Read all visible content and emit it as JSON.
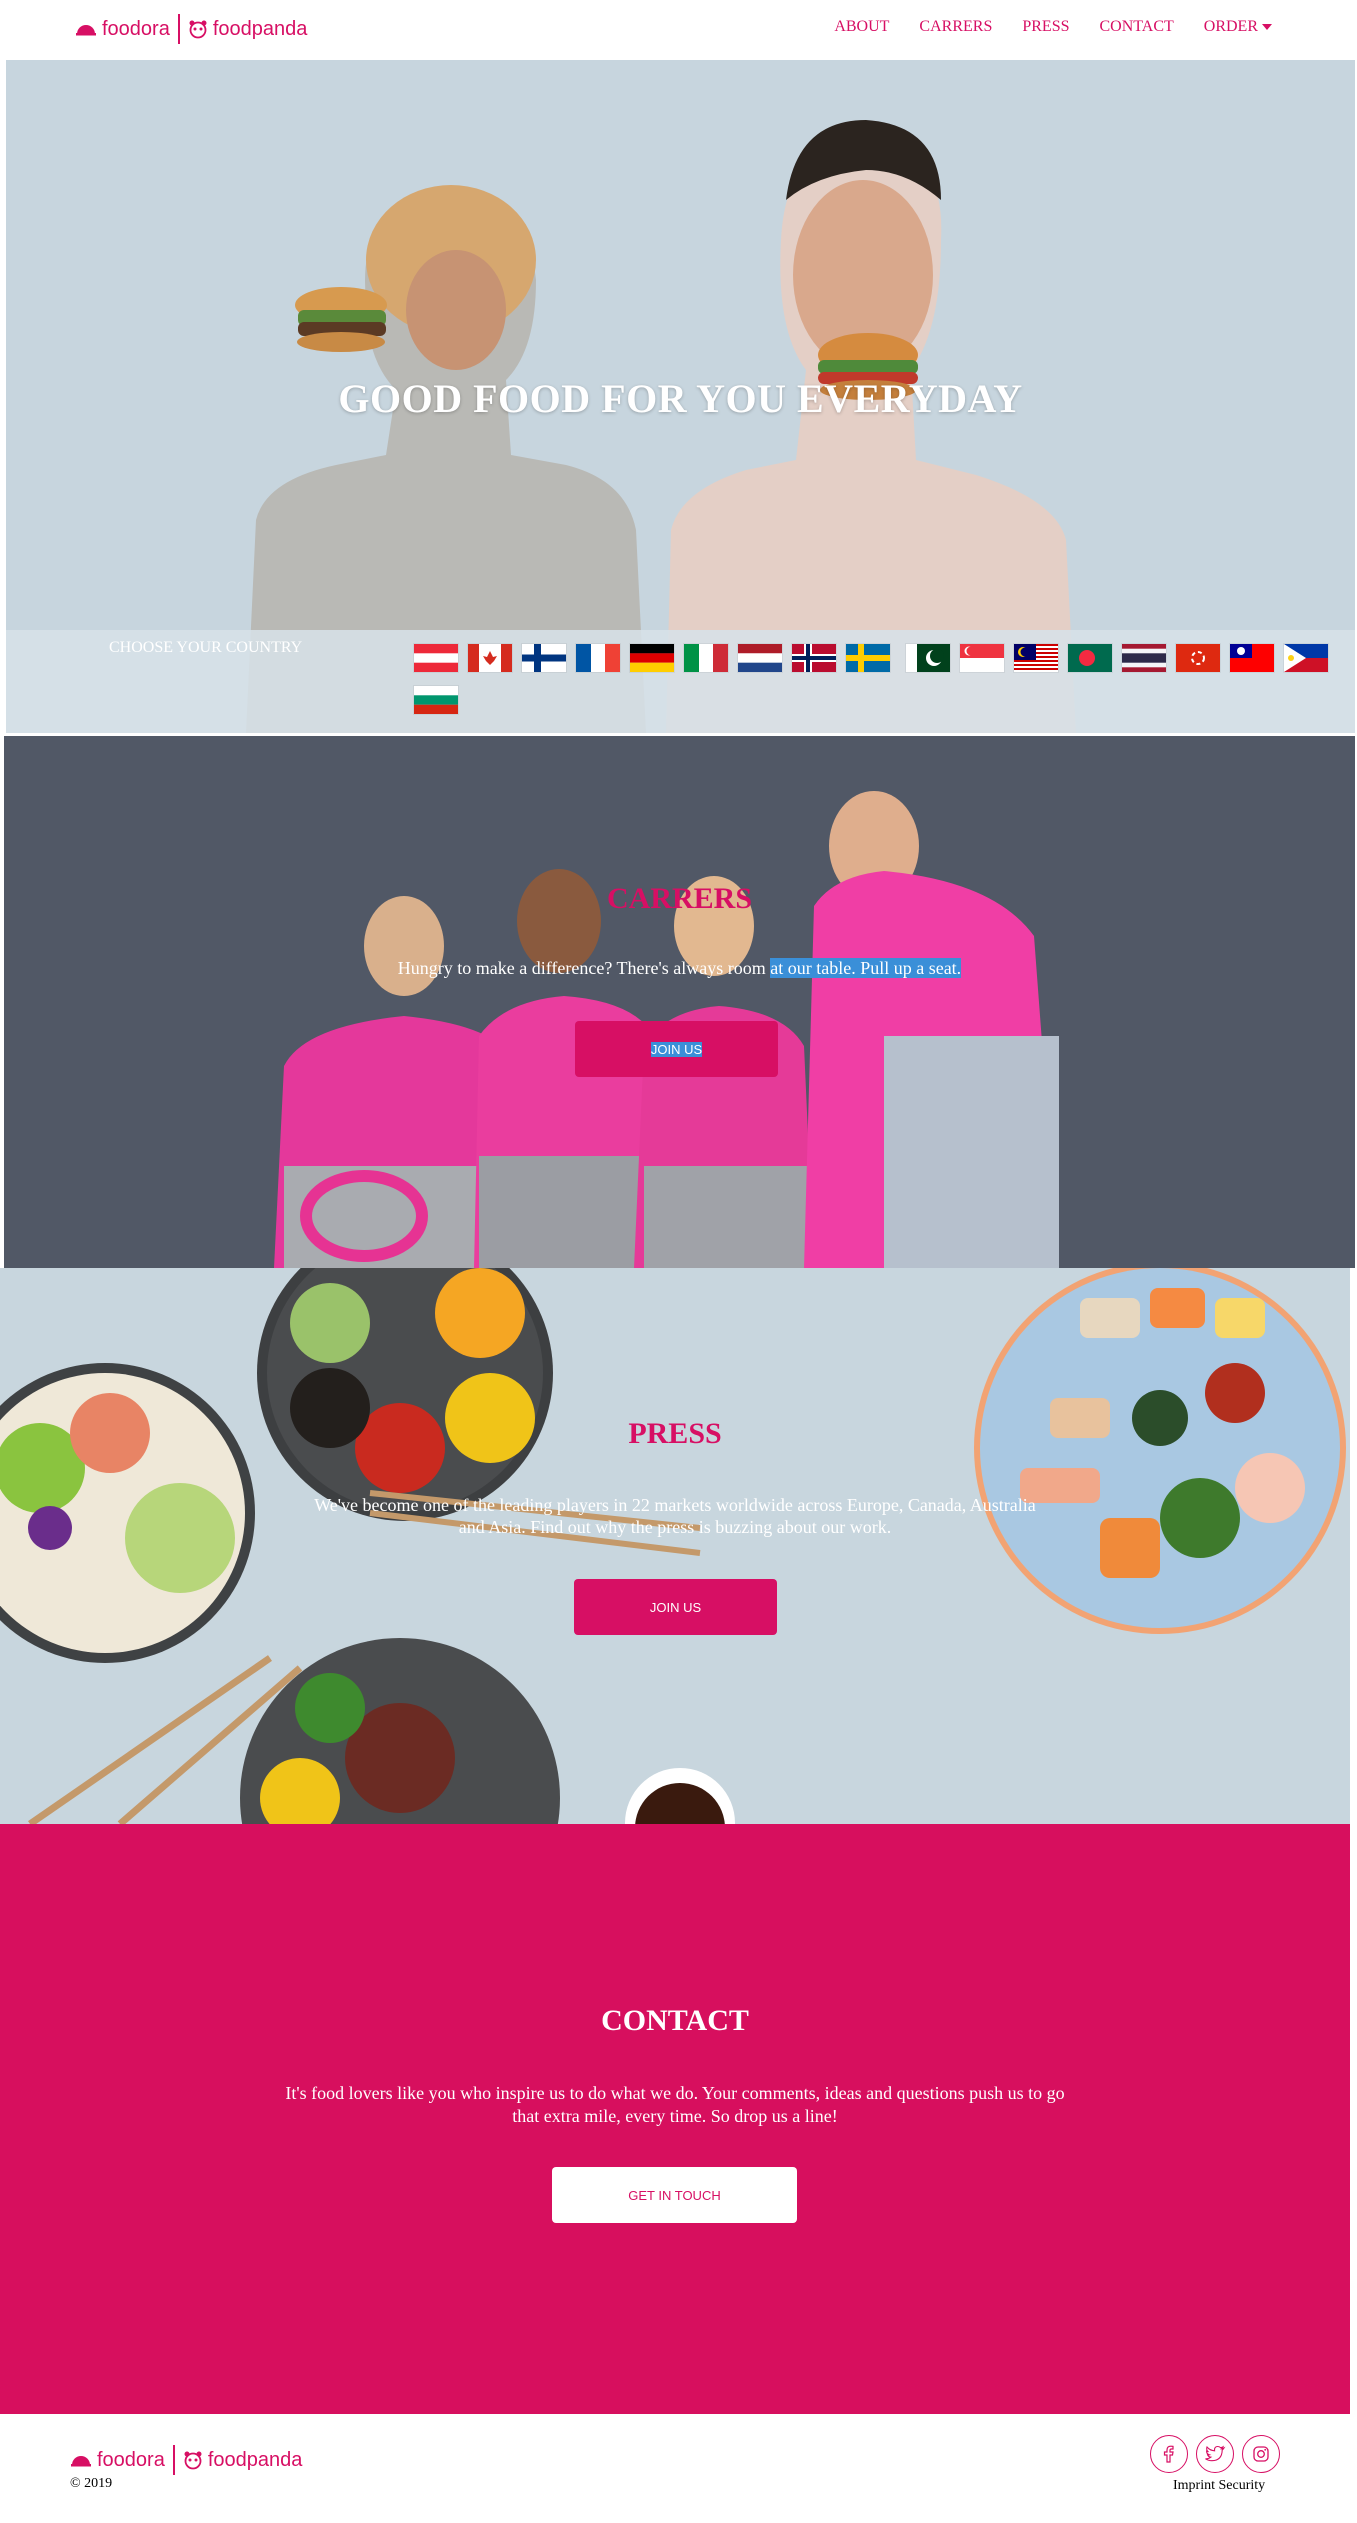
{
  "header": {
    "brand_left": "foodora",
    "brand_right": "foodpanda",
    "nav": [
      "ABOUT",
      "CARRERS",
      "PRESS",
      "CONTACT",
      "ORDER"
    ]
  },
  "hero": {
    "title": "GOOD FOOD FOR YOU EVERYDAY",
    "country_label": "CHOOSE YOUR COUNTRY",
    "flags": [
      "austria-flag",
      "canada-flag",
      "finland-flag",
      "france-flag",
      "germany-flag",
      "italy-flag",
      "netherlands-flag",
      "norway-flag",
      "sweden-flag",
      "pakistan-flag",
      "singapore-flag",
      "malaysia-flag",
      "bangladesh-flag",
      "thailand-flag",
      "hong-kong-flag",
      "taiwan-flag",
      "philippines-flag",
      "bulgaria-flag"
    ]
  },
  "careers": {
    "title": "CARRERS",
    "text_a": "Hungry to make a difference? There's always room ",
    "text_b": "at our table. Pull up a seat.",
    "button": "JOIN US"
  },
  "press": {
    "title": "PRESS",
    "text": "We've become one of the leading players in 22 markets worldwide across Europe, Canada, Australia and Asia. Find out why the press is buzzing about our work.",
    "button": "JOIN US"
  },
  "contact": {
    "title": "CONTACT",
    "text": "It's food lovers like you who inspire us to do what we do. Your comments, ideas and questions push us to go that extra mile, every time. So drop us a line!",
    "button": "GET IN TOUCH"
  },
  "footer": {
    "brand_left": "foodora",
    "brand_right": "foodpanda",
    "copyright": "© 2019",
    "links": "Imprint Security",
    "social": [
      "facebook-icon",
      "twitter-icon",
      "instagram-icon"
    ]
  },
  "colors": {
    "brand": "#d70f64",
    "hero_bg": "#c7d5de",
    "careers_bg": "#515866",
    "contact_bg": "#d70f5e"
  }
}
